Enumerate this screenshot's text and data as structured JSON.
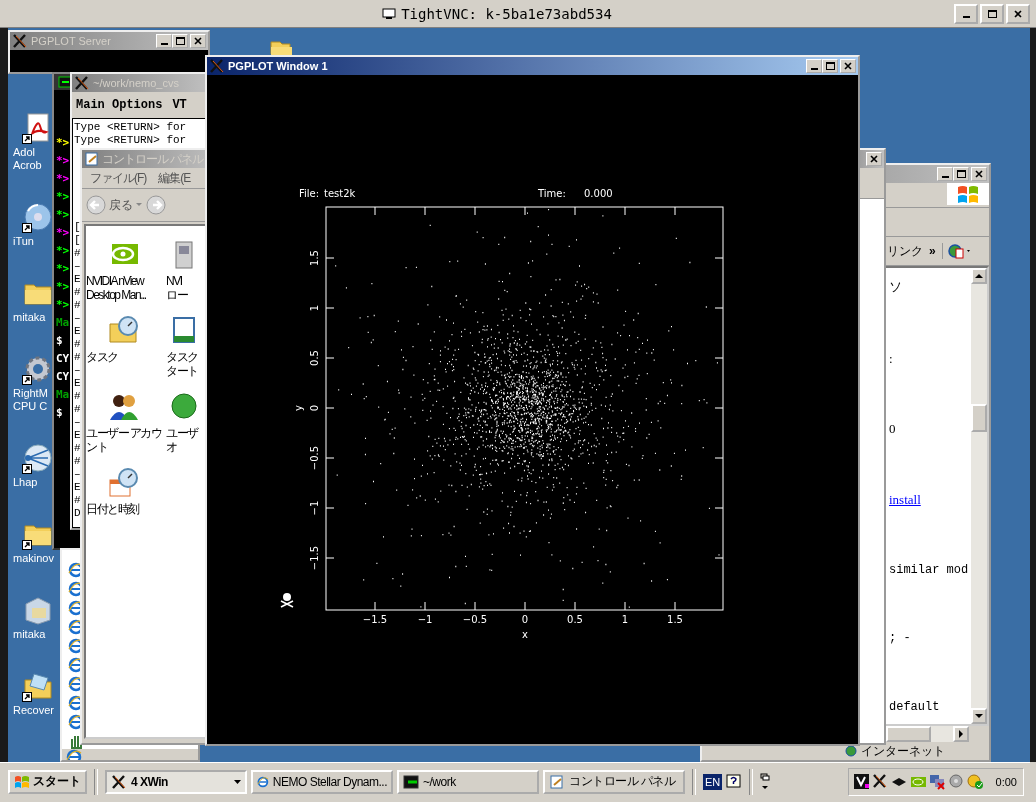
{
  "vnc_window": {
    "title": "TightVNC: k-5ba1e73abd534"
  },
  "desktop_icons": [
    {
      "kind": "pdf",
      "lines": [
        "Adol",
        "Acrob"
      ],
      "shortcut": true
    },
    {
      "kind": "disc",
      "lines": [
        "iTun"
      ],
      "shortcut": true
    },
    {
      "kind": "folder",
      "lines": [
        "mitaka"
      ],
      "shortcut": false
    },
    {
      "kind": "gear",
      "lines": [
        "RightM",
        "CPU C"
      ],
      "shortcut": true
    },
    {
      "kind": "network",
      "lines": [
        "Lhap"
      ],
      "shortcut": true
    },
    {
      "kind": "folder",
      "lines": [
        "makinov"
      ],
      "shortcut": true
    },
    {
      "kind": "box",
      "lines": [
        "mitaka"
      ],
      "shortcut": false
    },
    {
      "kind": "mail",
      "lines": [
        "Recover"
      ],
      "shortcut": true
    }
  ],
  "pgplot_server": {
    "title": "PGPLOT Server",
    "active": false
  },
  "xterm": {
    "lines": [
      {
        "text": "*>",
        "color": "#ffff00"
      },
      {
        "text": "*>",
        "color": "#ff00ff"
      },
      {
        "text": "*>",
        "color": "#ff00ff"
      },
      {
        "text": "*>",
        "color": "#00ff00"
      },
      {
        "text": "*>",
        "color": "#00ff00"
      },
      {
        "text": "*>",
        "color": "#ff00ff"
      },
      {
        "text": "*>",
        "color": "#00ff00"
      },
      {
        "text": "*>",
        "color": "#00ff00"
      },
      {
        "text": "*>",
        "color": "#00ff00"
      },
      {
        "text": "*>",
        "color": "#00ff00"
      },
      {
        "text": "Ma",
        "color": "#00a000"
      },
      {
        "text": "$",
        "color": "#ffffff"
      },
      {
        "text": "CY",
        "color": "#ffffff"
      },
      {
        "text": "CY",
        "color": "#ffffff"
      },
      {
        "text": "Ma",
        "color": "#00a000"
      },
      {
        "text": "$",
        "color": "#ffffff"
      }
    ]
  },
  "nemo_terminal": {
    "title": "~/work/nemo_cvs",
    "active": false,
    "menu": [
      "Main Options",
      "VT"
    ],
    "lines": [
      "Type <RETURN> for",
      "Type <RETURN> for",
      "[",
      "[",
      "#",
      "–",
      "E",
      "#",
      "#",
      "–",
      "E",
      "#",
      "#",
      "–",
      "E",
      "#",
      "#",
      "–",
      "E",
      "#",
      "#",
      "–",
      "E",
      "#",
      "D"
    ]
  },
  "control_panel": {
    "title": "コントロール パネル",
    "active": false,
    "menu": [
      "ファイル(F)",
      "編集(E"
    ],
    "back_label": "戻る",
    "items": [
      {
        "kind": "nvidia",
        "lines": [
          "NVIDIA nView",
          "Desktop Man..."
        ]
      },
      {
        "kind": "app",
        "lines": [
          "NVI",
          "ロー"
        ]
      },
      {
        "kind": "task",
        "lines": [
          "タスク"
        ]
      },
      {
        "kind": "taskbar",
        "lines": [
          "タスク",
          "タート"
        ]
      },
      {
        "kind": "users",
        "lines": [
          "ユーザー アカウ",
          "ント"
        ]
      },
      {
        "kind": "globe",
        "lines": [
          "ユーザ",
          "オ"
        ]
      },
      {
        "kind": "clock",
        "lines": [
          "日付と時刻"
        ]
      }
    ]
  },
  "browser": {
    "links_label": "リンク",
    "chevron": "»",
    "content": [
      {
        "kind": "text",
        "text": "ソ"
      },
      {
        "kind": "text",
        "text": ":"
      },
      {
        "kind": "text",
        "text": "0"
      },
      {
        "kind": "link",
        "text": "install"
      },
      {
        "kind": "mono",
        "text": "similar mod"
      },
      {
        "kind": "mono",
        "text": "; -"
      },
      {
        "kind": "mono",
        "text": "default"
      }
    ],
    "status": "インターネット"
  },
  "pgplot_window": {
    "title": "PGPLOT Window 1",
    "active": true,
    "file_label": "File:",
    "file_name": "test2k",
    "time_label": "Time:",
    "time_value": "0.000",
    "xlabel": "x",
    "ylabel": "y",
    "xticks": [
      "−1.5",
      "−1",
      "−0.5",
      "0",
      "0.5",
      "1",
      "1.5"
    ],
    "yticks": [
      "−1.5",
      "−1",
      "−0.5",
      "0",
      "0.5",
      "1",
      "1.5"
    ]
  },
  "taskbar": {
    "start": "スタート",
    "group": "4 XWin",
    "tasks": [
      {
        "kind": "ie",
        "label": "NEMO Stellar Dynam...",
        "selected": false
      },
      {
        "kind": "terminal",
        "label": "~/work",
        "selected": false
      },
      {
        "kind": "control",
        "label": "コントロール パネル",
        "selected": false
      }
    ],
    "language": "EN",
    "clock": "0:00"
  }
}
